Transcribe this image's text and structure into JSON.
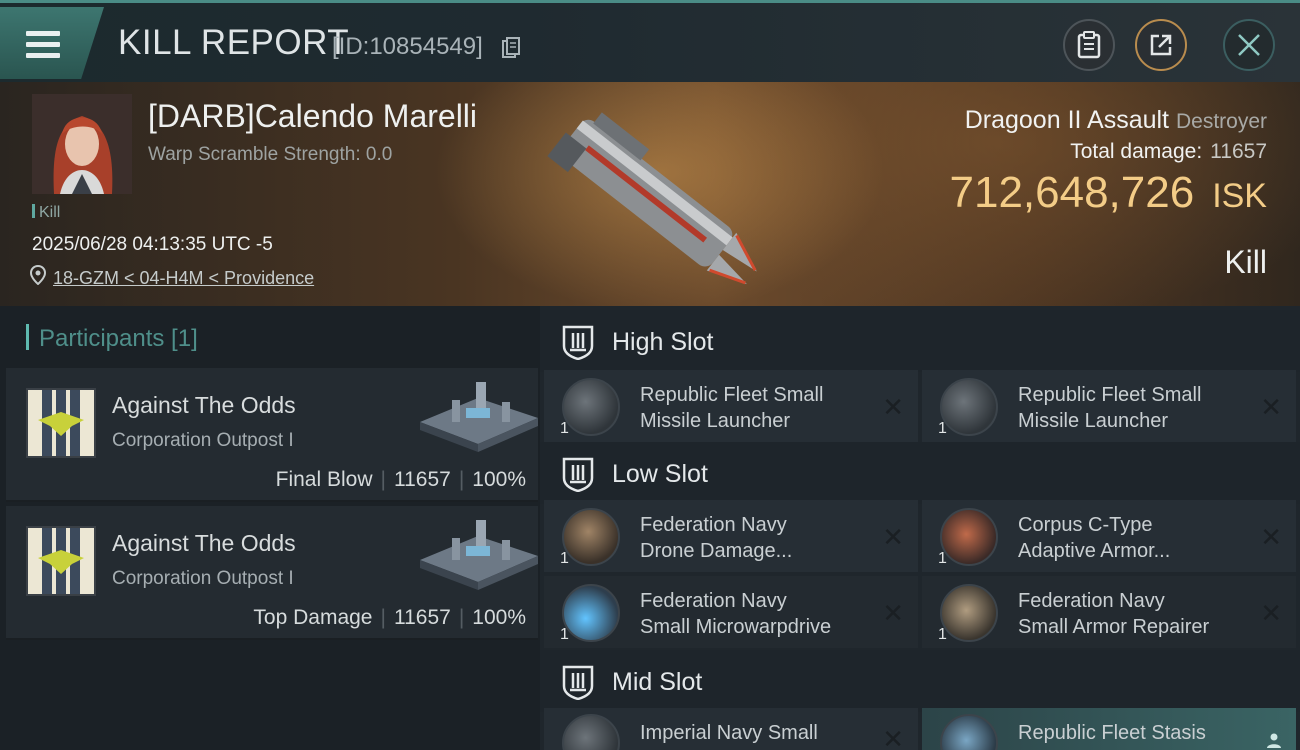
{
  "header": {
    "title": "KILL REPORT",
    "report_id": "[ID:10854549]"
  },
  "victim": {
    "name": "[DARB]Calendo Marelli",
    "warp_scramble": "Warp Scramble Strength: 0.0",
    "tag": "Kill",
    "datetime": "2025/06/28 04:13:35 UTC -5",
    "location": "18-GZM < 04-H4M < Providence"
  },
  "ship": {
    "name": "Dragoon II Assault",
    "class": "Destroyer",
    "total_damage_label": "Total damage:",
    "total_damage_value": "11657",
    "isk_value": "712,648,726",
    "isk_unit": "ISK",
    "result": "Kill"
  },
  "participants": {
    "header": "Participants [1]",
    "items": [
      {
        "name": "Against The Odds",
        "type": "Corporation Outpost I",
        "role": "Final Blow",
        "damage": "11657",
        "percent": "100%"
      },
      {
        "name": "Against The Odds",
        "type": "Corporation Outpost I",
        "role": "Top Damage",
        "damage": "11657",
        "percent": "100%"
      }
    ]
  },
  "slots": {
    "high": {
      "label": "High Slot",
      "items": [
        {
          "name": "Republic Fleet Small\nMissile Launcher",
          "qty": "1"
        },
        {
          "name": "Republic Fleet Small\nMissile Launcher",
          "qty": "1"
        }
      ]
    },
    "low": {
      "label": "Low Slot",
      "items": [
        {
          "name": "Federation Navy\nDrone Damage...",
          "qty": "1"
        },
        {
          "name": "Corpus C-Type\nAdaptive Armor...",
          "qty": "1"
        },
        {
          "name": "Federation Navy\nSmall Microwarpdrive",
          "qty": "1"
        },
        {
          "name": "Federation Navy\nSmall Armor Repairer",
          "qty": "1"
        }
      ]
    },
    "mid": {
      "label": "Mid Slot",
      "items": [
        {
          "name": "Imperial Navy Small",
          "qty": ""
        },
        {
          "name": "Republic Fleet Stasis",
          "qty": ""
        }
      ]
    }
  },
  "icons": {
    "menu": "menu-icon",
    "copy": "copy-icon",
    "clipboard": "clipboard-icon",
    "share": "share-icon",
    "close": "close-icon",
    "location": "location-pin-icon",
    "slot": "slot-shield-icon",
    "remove": "x-icon"
  },
  "colors": {
    "accent": "#5fa8a0",
    "isk": "#f3cc87",
    "share_ring": "#b98c4e"
  }
}
